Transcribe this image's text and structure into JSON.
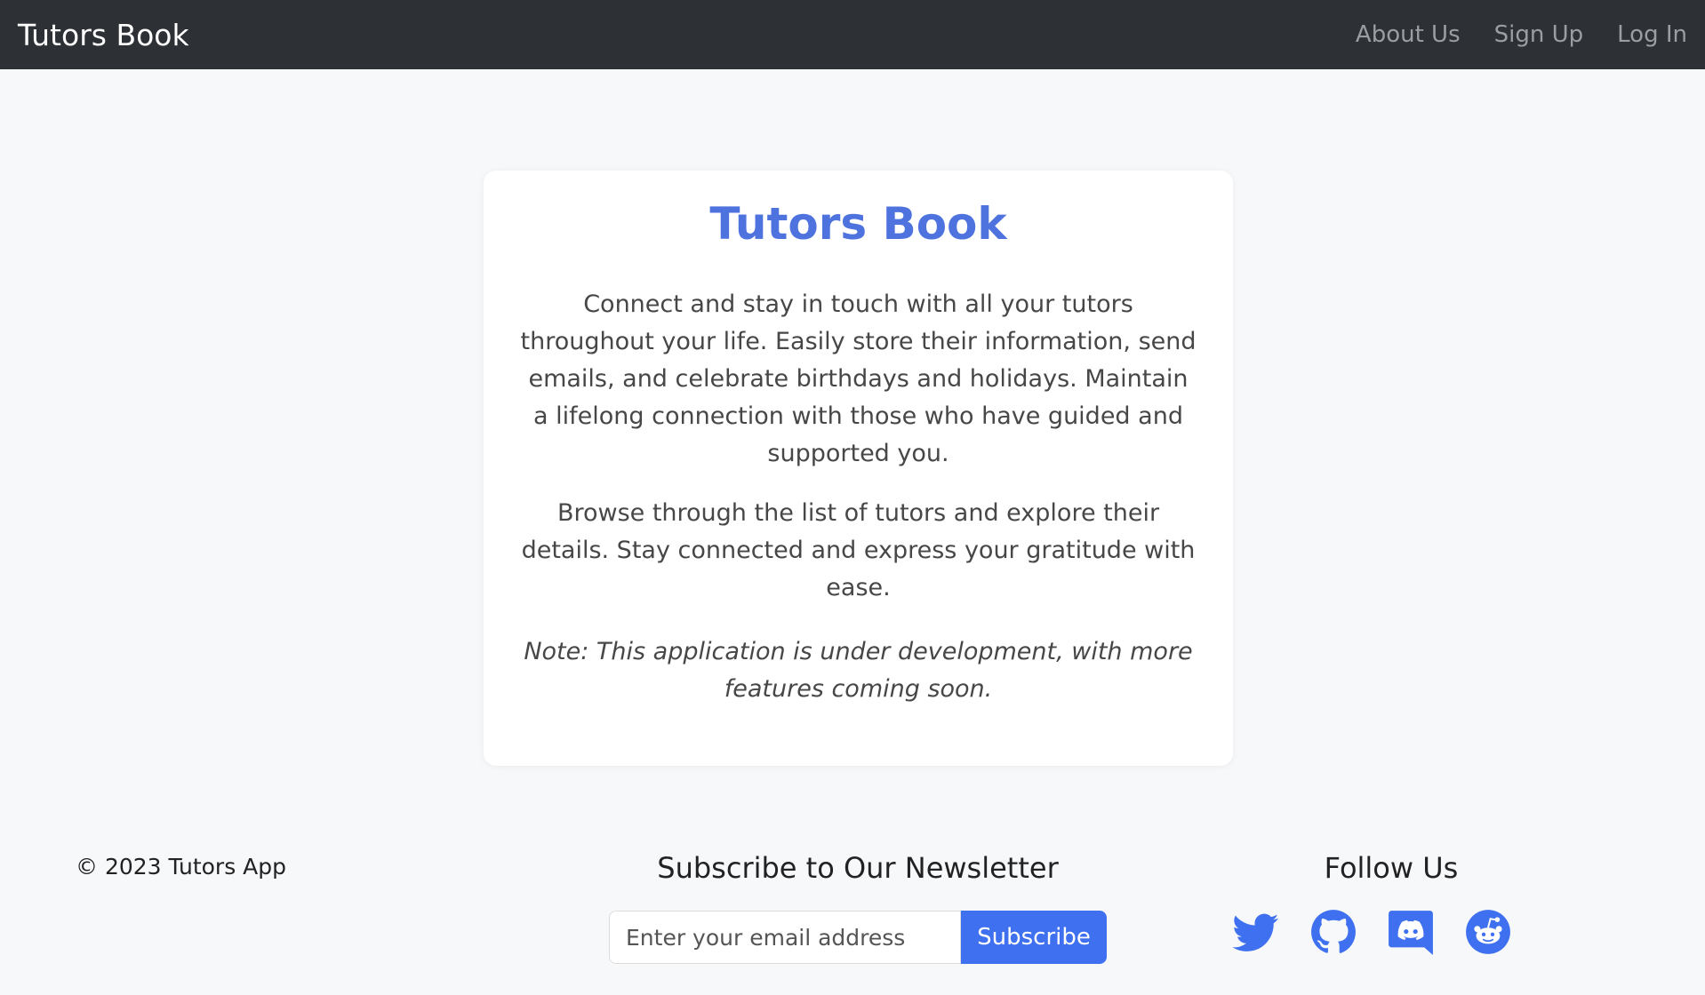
{
  "navbar": {
    "brand": "Tutors Book",
    "links": [
      "About Us",
      "Sign Up",
      "Log In"
    ]
  },
  "card": {
    "title": "Tutors Book",
    "paragraph1": "Connect and stay in touch with all your tutors throughout your life. Easily store their information, send emails, and celebrate birthdays and holidays. Maintain a lifelong connection with those who have guided and supported you.",
    "paragraph2": "Browse through the list of tutors and explore their details. Stay connected and express your gratitude with ease.",
    "note": "Note: This application is under development, with more features coming soon."
  },
  "footer": {
    "copyright": "© 2023 Tutors App",
    "newsletter": {
      "title": "Subscribe to Our Newsletter",
      "placeholder": "Enter your email address",
      "button": "Subscribe"
    },
    "follow": {
      "title": "Follow Us",
      "icons": [
        "twitter-icon",
        "github-icon",
        "discord-icon",
        "reddit-icon"
      ]
    }
  },
  "colors": {
    "navbar_bg": "#2d3035",
    "accent": "#4e73df",
    "button": "#3e70ef",
    "page_bg": "#f7f8fa"
  }
}
